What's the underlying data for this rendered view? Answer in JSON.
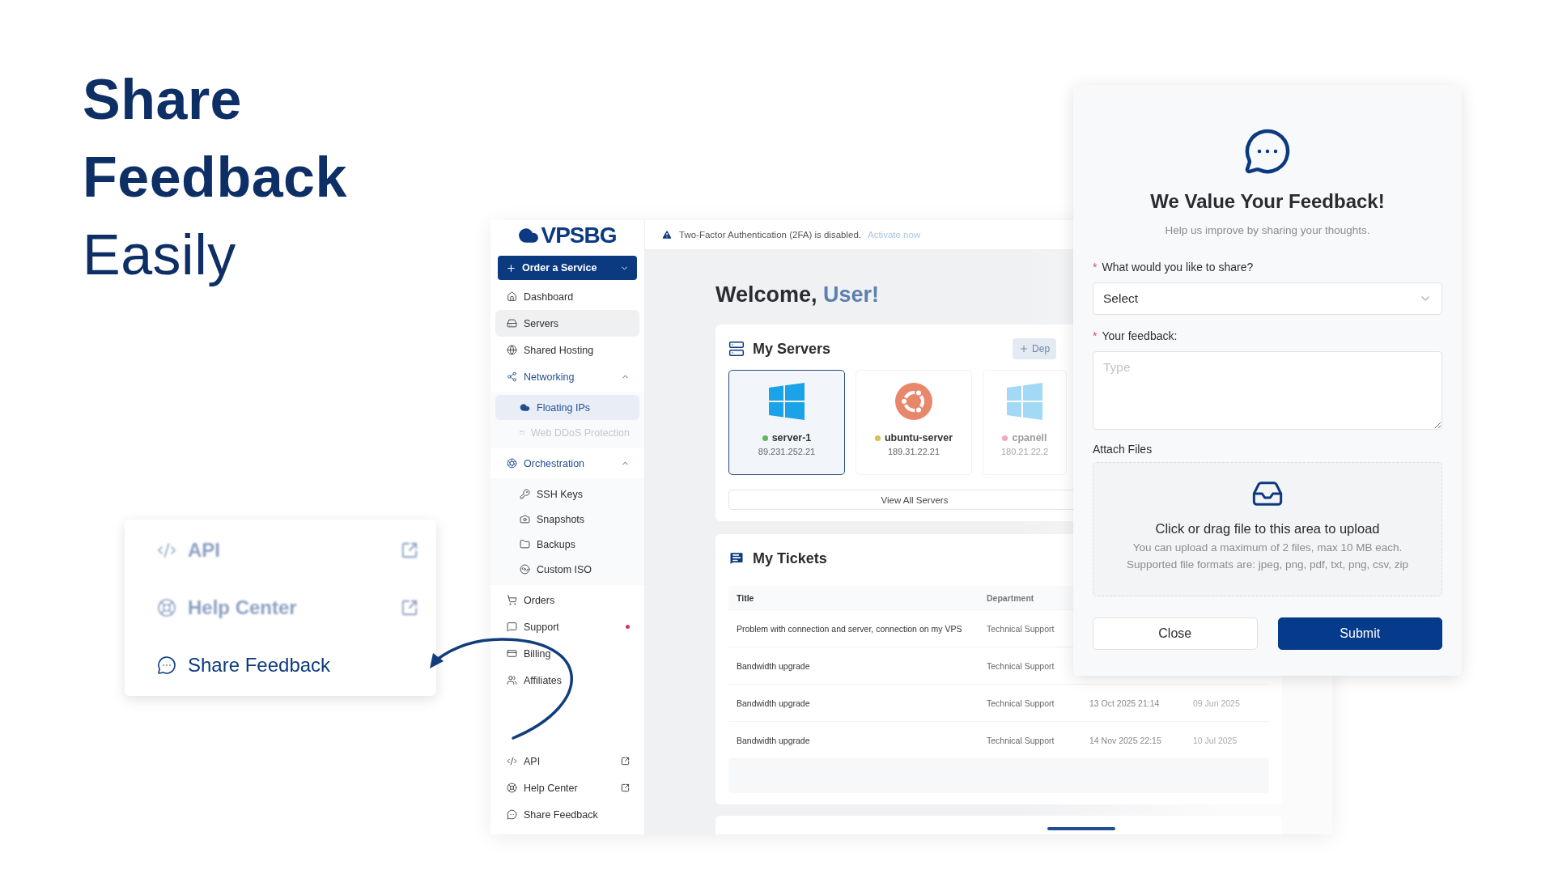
{
  "headline": [
    {
      "text": "Share",
      "emphasis": true
    },
    {
      "text": "Feedback",
      "emphasis": true
    },
    {
      "text": "Easily",
      "emphasis": false
    }
  ],
  "callout": {
    "items": [
      {
        "label": "API",
        "blurred": true,
        "external": true
      },
      {
        "label": "Help Center",
        "blurred": true,
        "external": true
      },
      {
        "label": "Share Feedback",
        "blurred": false,
        "external": false
      }
    ]
  },
  "app": {
    "logo": "VPSBG",
    "order_button": "Order a Service",
    "sidebar": {
      "items": [
        {
          "label": "Dashboard",
          "selected": false
        },
        {
          "label": "Servers",
          "selected": true
        },
        {
          "label": "Shared Hosting",
          "selected": false
        },
        {
          "label": "Networking",
          "selected": false,
          "expanded": true,
          "children": [
            {
              "label": "Floating IPs",
              "selected": true,
              "disabled": false
            },
            {
              "label": "Web DDoS Protection",
              "selected": false,
              "disabled": true
            }
          ]
        },
        {
          "label": "Orchestration",
          "selected": false,
          "expanded": true,
          "children": [
            {
              "label": "SSH Keys",
              "selected": false,
              "disabled": false
            },
            {
              "label": "Snapshots",
              "selected": false,
              "disabled": false
            },
            {
              "label": "Backups",
              "selected": false,
              "disabled": false
            },
            {
              "label": "Custom ISO",
              "selected": false,
              "disabled": false
            }
          ]
        },
        {
          "label": "Orders",
          "selected": false
        },
        {
          "label": "Support",
          "selected": false,
          "alert": true
        },
        {
          "label": "Billing",
          "selected": false
        },
        {
          "label": "Affiliates",
          "selected": false
        }
      ],
      "footer_items": [
        {
          "label": "API",
          "external": true
        },
        {
          "label": "Help Center",
          "external": true
        },
        {
          "label": "Share Feedback",
          "external": false
        }
      ]
    },
    "alert": {
      "text": "Two-Factor Authentication (2FA) is disabled.",
      "link": "Activate now"
    },
    "welcome": {
      "text": "Welcome,",
      "name": "User!"
    },
    "servers": {
      "title": "My Servers",
      "deploy": "Dep",
      "view_all": "View All Servers",
      "cards": [
        {
          "name": "server-1",
          "ip": "89.231.252.21",
          "kind": "windows",
          "selected": true,
          "faded": false,
          "color": "#5fb760"
        },
        {
          "name": "ubuntu-server",
          "ip": "189.31.22.21",
          "kind": "ubuntu",
          "selected": false,
          "faded": false,
          "color": "#d6bf55"
        },
        {
          "name": "cpanell",
          "ip": "180.21.22.2",
          "kind": "windows",
          "selected": false,
          "faded": true,
          "color": "#f3a9b8"
        }
      ]
    },
    "tickets": {
      "title": "My Tickets",
      "columns": [
        "Title",
        "Department"
      ],
      "rows": [
        {
          "title": "Problem with connection and server, connection on my VPS",
          "department": "Technical Support"
        },
        {
          "title": "Bandwidth upgrade",
          "department": "Technical Support"
        },
        {
          "title": "Bandwidth upgrade",
          "department": "Technical Support",
          "created": "13 Oct 2025 21:14",
          "updated": "09 Jun 2025"
        },
        {
          "title": "Bandwidth upgrade",
          "department": "Technical Support",
          "created": "14 Nov 2025 22:15",
          "updated": "10 Jul 2025"
        }
      ]
    }
  },
  "modal": {
    "title": "We Value Your Feedback!",
    "subtitle": "Help us improve by sharing your thoughts.",
    "fields": [
      {
        "kind": "select",
        "label": "What would you like to share?",
        "required_mark": "*",
        "value": "Select"
      },
      {
        "kind": "textarea",
        "label": "Your feedback:",
        "required_mark": "*",
        "placeholder": "Type"
      }
    ],
    "attach": {
      "label": "Attach Files",
      "title": "Click or drag file to this area to upload",
      "lines": [
        "You can upload a maximum of 2 files, max 10 MB each.",
        "Supported file formats are: jpeg, png, pdf, txt, png, csv, zip"
      ]
    },
    "buttons": [
      {
        "label": "Close",
        "primary": false
      },
      {
        "label": "Submit",
        "primary": true
      }
    ]
  }
}
